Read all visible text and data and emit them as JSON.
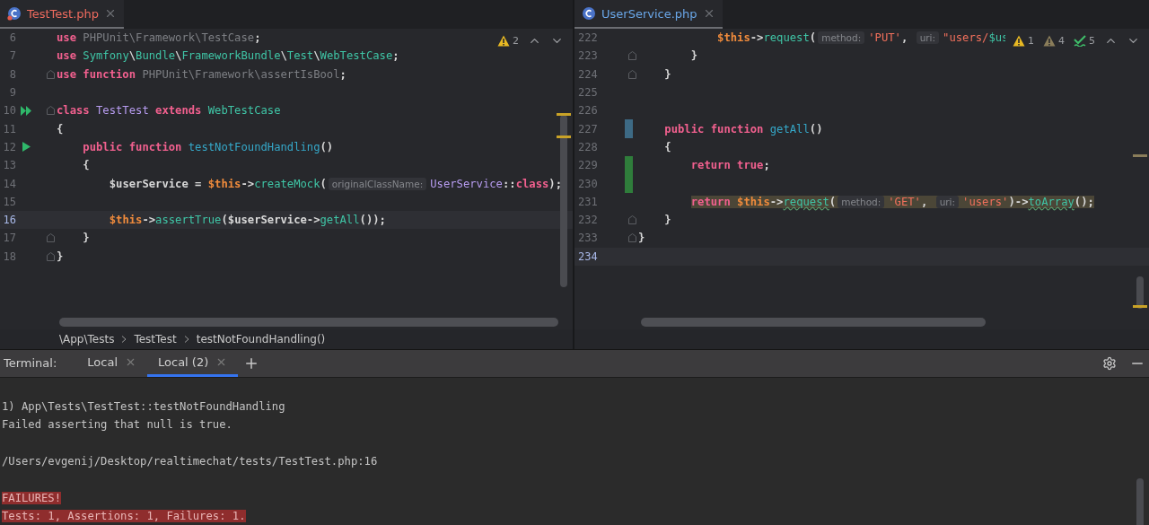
{
  "editors": [
    {
      "tab": {
        "label": "TestTest.php",
        "has_errors": true,
        "selected": true
      },
      "inspections": [
        {
          "kind": "warning",
          "count": "2"
        }
      ],
      "lines": [
        {
          "number": "6",
          "kind": "code",
          "current": false,
          "tokens": [
            {
              "kind": "kw",
              "text": "use"
            },
            {
              "kind": "dim",
              "text": " PHPUnit\\Framework\\TestCase"
            },
            {
              "kind": "plain",
              "text": ";"
            }
          ]
        },
        {
          "number": "7",
          "kind": "code",
          "current": false,
          "tokens": [
            {
              "kind": "kw",
              "text": "use"
            },
            {
              "kind": "type",
              "text": " Symfony"
            },
            {
              "kind": "plain",
              "text": "\\"
            },
            {
              "kind": "type",
              "text": "Bundle"
            },
            {
              "kind": "plain",
              "text": "\\"
            },
            {
              "kind": "type",
              "text": "FrameworkBundle"
            },
            {
              "kind": "plain",
              "text": "\\"
            },
            {
              "kind": "type",
              "text": "Test"
            },
            {
              "kind": "plain",
              "text": "\\"
            },
            {
              "kind": "type",
              "text": "WebTestCase"
            },
            {
              "kind": "plain",
              "text": ";"
            }
          ]
        },
        {
          "number": "8",
          "kind": "fold",
          "current": false,
          "tokens": [
            {
              "kind": "kw",
              "text": "use function"
            },
            {
              "kind": "dim",
              "text": " PHPUnit\\Framework\\assertIsBool"
            },
            {
              "kind": "plain",
              "text": ";"
            }
          ]
        },
        {
          "number": "9",
          "kind": "code",
          "current": false
        },
        {
          "number": "10",
          "kind": "run-all",
          "current": false,
          "tokens": [
            {
              "kind": "kw",
              "text": "class"
            },
            {
              "kind": "name",
              "text": " TestTest"
            },
            {
              "kind": "kw",
              "text": " extends"
            },
            {
              "kind": "type",
              "text": " WebTestCase"
            }
          ]
        },
        {
          "number": "11",
          "kind": "code",
          "current": false,
          "tokens": [
            {
              "kind": "plain",
              "text": "{"
            }
          ]
        },
        {
          "number": "12",
          "kind": "run",
          "current": false,
          "tokens": [
            {
              "kind": "kw",
              "text": "    public function"
            },
            {
              "kind": "fn",
              "text": " testNotFoundHandling"
            },
            {
              "kind": "plain",
              "text": "()"
            }
          ]
        },
        {
          "number": "13",
          "kind": "code",
          "current": false,
          "tokens": [
            {
              "kind": "plain",
              "text": "    {"
            }
          ]
        },
        {
          "number": "14",
          "kind": "code",
          "current": false,
          "tokens": [
            {
              "kind": "plain",
              "text": "        $userService = "
            },
            {
              "kind": "this",
              "text": "$this"
            },
            {
              "kind": "plain",
              "text": "->"
            },
            {
              "kind": "call",
              "text": "createMock"
            },
            {
              "kind": "plain",
              "text": "("
            },
            {
              "kind": "hint",
              "text": "originalClassName:"
            },
            {
              "kind": "name",
              "text": "UserService"
            },
            {
              "kind": "plain",
              "text": "::"
            },
            {
              "kind": "kw",
              "text": "class"
            },
            {
              "kind": "plain",
              "text": ");"
            }
          ]
        },
        {
          "number": "15",
          "kind": "code",
          "current": false
        },
        {
          "number": "16",
          "kind": "code",
          "current": true,
          "tokens": [
            {
              "kind": "this",
              "text": "        $this"
            },
            {
              "kind": "plain",
              "text": "->"
            },
            {
              "kind": "call",
              "text": "assertTrue"
            },
            {
              "kind": "plain",
              "text": "($userService->"
            },
            {
              "kind": "call",
              "text": "getAll"
            },
            {
              "kind": "plain",
              "text": "());"
            }
          ]
        },
        {
          "number": "17",
          "kind": "fold",
          "current": false,
          "tokens": [
            {
              "kind": "plain",
              "text": "    }"
            }
          ]
        },
        {
          "number": "18",
          "kind": "fold",
          "current": false,
          "tokens": [
            {
              "kind": "plain",
              "text": "}"
            }
          ]
        }
      ],
      "breadcrumbs": [
        "\\App\\Tests",
        "TestTest",
        "testNotFoundHandling()"
      ]
    },
    {
      "tab": {
        "label": "UserService.php",
        "has_errors": false,
        "selected": true
      },
      "inspections": [
        {
          "kind": "warning",
          "count": "1"
        },
        {
          "kind": "weak-warning",
          "count": "4"
        },
        {
          "kind": "typo",
          "count": "5"
        }
      ],
      "lines": [
        {
          "number": "222",
          "kind": "code",
          "current": false,
          "tokens": [
            {
              "kind": "this",
              "text": "            $this"
            },
            {
              "kind": "plain",
              "text": "->"
            },
            {
              "kind": "call",
              "text": "request"
            },
            {
              "kind": "plain",
              "text": "("
            },
            {
              "kind": "hint",
              "text": "method:"
            },
            {
              "kind": "str",
              "text": "'PUT'"
            },
            {
              "kind": "plain",
              "text": ","
            },
            {
              "kind": "hint",
              "text": "uri:"
            },
            {
              "kind": "str",
              "text": "\"users/"
            },
            {
              "kind": "type",
              "text": "$us"
            }
          ]
        },
        {
          "number": "223",
          "kind": "fold",
          "current": false,
          "tokens": [
            {
              "kind": "plain",
              "text": "        }"
            }
          ]
        },
        {
          "number": "224",
          "kind": "fold",
          "current": false,
          "tokens": [
            {
              "kind": "plain",
              "text": "    }"
            }
          ]
        },
        {
          "number": "225",
          "kind": "code",
          "current": false
        },
        {
          "number": "226",
          "kind": "code",
          "current": false
        },
        {
          "number": "227",
          "kind": "modified",
          "current": false,
          "tokens": [
            {
              "kind": "kw",
              "text": "    public function"
            },
            {
              "kind": "fn",
              "text": " getAll"
            },
            {
              "kind": "plain",
              "text": "()"
            }
          ]
        },
        {
          "number": "228",
          "kind": "code",
          "current": false,
          "tokens": [
            {
              "kind": "plain",
              "text": "    {"
            }
          ]
        },
        {
          "number": "229",
          "kind": "added",
          "current": false,
          "tokens": [
            {
              "kind": "kw",
              "text": "        return true"
            },
            {
              "kind": "plain",
              "text": ";"
            }
          ]
        },
        {
          "number": "230",
          "kind": "added",
          "current": false
        },
        {
          "number": "231",
          "kind": "code",
          "current": false,
          "highlighted": true,
          "tokens": [
            {
              "kind": "kw",
              "text": "        return"
            },
            {
              "kind": "this",
              "text": " $this"
            },
            {
              "kind": "plain",
              "text": "->"
            },
            {
              "kind": "warnfn",
              "text": "request"
            },
            {
              "kind": "plain",
              "text": "("
            },
            {
              "kind": "hint",
              "text": "method:"
            },
            {
              "kind": "str",
              "text": "'GET'"
            },
            {
              "kind": "plain",
              "text": ","
            },
            {
              "kind": "hint",
              "text": "uri:"
            },
            {
              "kind": "str",
              "text": "'users'"
            },
            {
              "kind": "plain",
              "text": ")->"
            },
            {
              "kind": "warnfn",
              "text": "toArray"
            },
            {
              "kind": "plain",
              "text": "();"
            }
          ]
        },
        {
          "number": "232",
          "kind": "fold",
          "current": false,
          "tokens": [
            {
              "kind": "plain",
              "text": "    }"
            }
          ]
        },
        {
          "number": "233",
          "kind": "fold",
          "current": false,
          "tokens": [
            {
              "kind": "plain",
              "text": "}"
            }
          ]
        },
        {
          "number": "234",
          "kind": "code",
          "current": true
        }
      ]
    }
  ],
  "terminal": {
    "title": "Terminal:",
    "tabs": [
      {
        "label": "Local",
        "selected": false
      },
      {
        "label": "Local (2)",
        "selected": true
      }
    ],
    "blocks": [
      [
        {
          "kind": "output",
          "text": "1) App\\Tests\\TestTest::testNotFoundHandling"
        },
        {
          "kind": "output",
          "text": "Failed asserting that null is true."
        }
      ],
      [
        {
          "kind": "output",
          "text": "/Users/evgenij/Desktop/realtimechat/tests/TestTest.php:16"
        }
      ],
      [
        {
          "kind": "error",
          "text": "FAILURES!"
        },
        {
          "kind": "error",
          "text": "Tests: 1, Assertions: 1, Failures: 1."
        }
      ]
    ]
  }
}
